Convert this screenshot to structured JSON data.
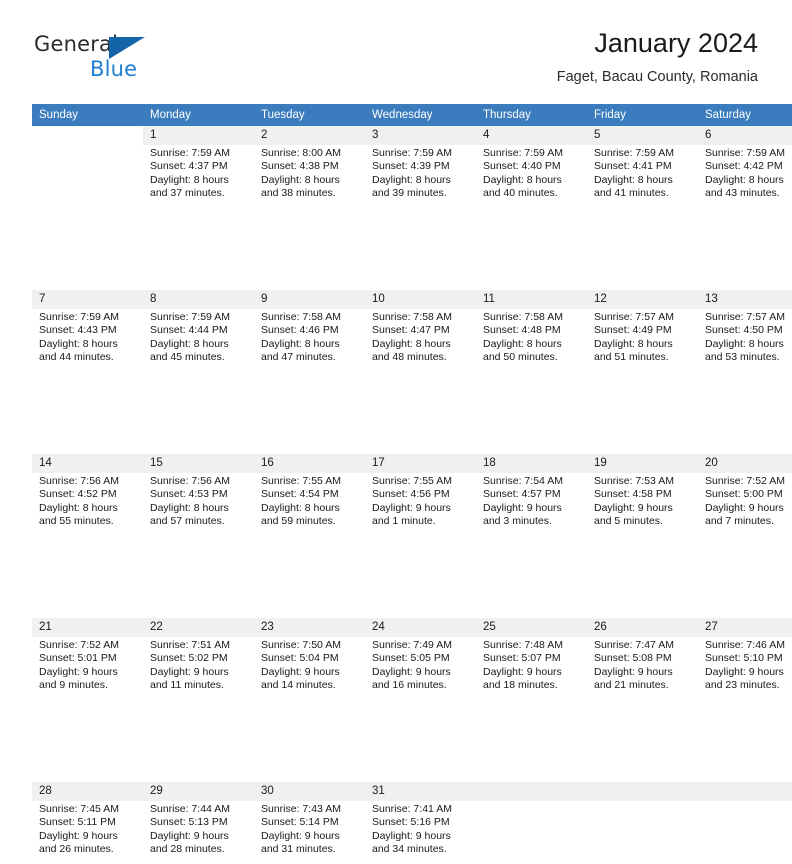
{
  "brand": {
    "name_part1": "General",
    "name_part2": "Blue",
    "triangle_icon": "blue-triangle-icon",
    "accent_color": "#1f7fd0",
    "triangle_color": "#1464aa"
  },
  "header": {
    "title": "January 2024",
    "subtitle": "Faget, Bacau County, Romania"
  },
  "calendar": {
    "header_bg": "#3a7cbe",
    "daynum_bg": "#f0f0f0",
    "weekdays": [
      "Sunday",
      "Monday",
      "Tuesday",
      "Wednesday",
      "Thursday",
      "Friday",
      "Saturday"
    ],
    "weeks": [
      [
        {
          "day": "",
          "blank": true,
          "sunrise": "",
          "sunset": "",
          "daylight1": "",
          "daylight2": ""
        },
        {
          "day": "1",
          "sunrise": "Sunrise: 7:59 AM",
          "sunset": "Sunset: 4:37 PM",
          "daylight1": "Daylight: 8 hours",
          "daylight2": "and 37 minutes."
        },
        {
          "day": "2",
          "sunrise": "Sunrise: 8:00 AM",
          "sunset": "Sunset: 4:38 PM",
          "daylight1": "Daylight: 8 hours",
          "daylight2": "and 38 minutes."
        },
        {
          "day": "3",
          "sunrise": "Sunrise: 7:59 AM",
          "sunset": "Sunset: 4:39 PM",
          "daylight1": "Daylight: 8 hours",
          "daylight2": "and 39 minutes."
        },
        {
          "day": "4",
          "sunrise": "Sunrise: 7:59 AM",
          "sunset": "Sunset: 4:40 PM",
          "daylight1": "Daylight: 8 hours",
          "daylight2": "and 40 minutes."
        },
        {
          "day": "5",
          "sunrise": "Sunrise: 7:59 AM",
          "sunset": "Sunset: 4:41 PM",
          "daylight1": "Daylight: 8 hours",
          "daylight2": "and 41 minutes."
        },
        {
          "day": "6",
          "sunrise": "Sunrise: 7:59 AM",
          "sunset": "Sunset: 4:42 PM",
          "daylight1": "Daylight: 8 hours",
          "daylight2": "and 43 minutes."
        }
      ],
      [
        {
          "day": "7",
          "sunrise": "Sunrise: 7:59 AM",
          "sunset": "Sunset: 4:43 PM",
          "daylight1": "Daylight: 8 hours",
          "daylight2": "and 44 minutes."
        },
        {
          "day": "8",
          "sunrise": "Sunrise: 7:59 AM",
          "sunset": "Sunset: 4:44 PM",
          "daylight1": "Daylight: 8 hours",
          "daylight2": "and 45 minutes."
        },
        {
          "day": "9",
          "sunrise": "Sunrise: 7:58 AM",
          "sunset": "Sunset: 4:46 PM",
          "daylight1": "Daylight: 8 hours",
          "daylight2": "and 47 minutes."
        },
        {
          "day": "10",
          "sunrise": "Sunrise: 7:58 AM",
          "sunset": "Sunset: 4:47 PM",
          "daylight1": "Daylight: 8 hours",
          "daylight2": "and 48 minutes."
        },
        {
          "day": "11",
          "sunrise": "Sunrise: 7:58 AM",
          "sunset": "Sunset: 4:48 PM",
          "daylight1": "Daylight: 8 hours",
          "daylight2": "and 50 minutes."
        },
        {
          "day": "12",
          "sunrise": "Sunrise: 7:57 AM",
          "sunset": "Sunset: 4:49 PM",
          "daylight1": "Daylight: 8 hours",
          "daylight2": "and 51 minutes."
        },
        {
          "day": "13",
          "sunrise": "Sunrise: 7:57 AM",
          "sunset": "Sunset: 4:50 PM",
          "daylight1": "Daylight: 8 hours",
          "daylight2": "and 53 minutes."
        }
      ],
      [
        {
          "day": "14",
          "sunrise": "Sunrise: 7:56 AM",
          "sunset": "Sunset: 4:52 PM",
          "daylight1": "Daylight: 8 hours",
          "daylight2": "and 55 minutes."
        },
        {
          "day": "15",
          "sunrise": "Sunrise: 7:56 AM",
          "sunset": "Sunset: 4:53 PM",
          "daylight1": "Daylight: 8 hours",
          "daylight2": "and 57 minutes."
        },
        {
          "day": "16",
          "sunrise": "Sunrise: 7:55 AM",
          "sunset": "Sunset: 4:54 PM",
          "daylight1": "Daylight: 8 hours",
          "daylight2": "and 59 minutes."
        },
        {
          "day": "17",
          "sunrise": "Sunrise: 7:55 AM",
          "sunset": "Sunset: 4:56 PM",
          "daylight1": "Daylight: 9 hours",
          "daylight2": "and 1 minute."
        },
        {
          "day": "18",
          "sunrise": "Sunrise: 7:54 AM",
          "sunset": "Sunset: 4:57 PM",
          "daylight1": "Daylight: 9 hours",
          "daylight2": "and 3 minutes."
        },
        {
          "day": "19",
          "sunrise": "Sunrise: 7:53 AM",
          "sunset": "Sunset: 4:58 PM",
          "daylight1": "Daylight: 9 hours",
          "daylight2": "and 5 minutes."
        },
        {
          "day": "20",
          "sunrise": "Sunrise: 7:52 AM",
          "sunset": "Sunset: 5:00 PM",
          "daylight1": "Daylight: 9 hours",
          "daylight2": "and 7 minutes."
        }
      ],
      [
        {
          "day": "21",
          "sunrise": "Sunrise: 7:52 AM",
          "sunset": "Sunset: 5:01 PM",
          "daylight1": "Daylight: 9 hours",
          "daylight2": "and 9 minutes."
        },
        {
          "day": "22",
          "sunrise": "Sunrise: 7:51 AM",
          "sunset": "Sunset: 5:02 PM",
          "daylight1": "Daylight: 9 hours",
          "daylight2": "and 11 minutes."
        },
        {
          "day": "23",
          "sunrise": "Sunrise: 7:50 AM",
          "sunset": "Sunset: 5:04 PM",
          "daylight1": "Daylight: 9 hours",
          "daylight2": "and 14 minutes."
        },
        {
          "day": "24",
          "sunrise": "Sunrise: 7:49 AM",
          "sunset": "Sunset: 5:05 PM",
          "daylight1": "Daylight: 9 hours",
          "daylight2": "and 16 minutes."
        },
        {
          "day": "25",
          "sunrise": "Sunrise: 7:48 AM",
          "sunset": "Sunset: 5:07 PM",
          "daylight1": "Daylight: 9 hours",
          "daylight2": "and 18 minutes."
        },
        {
          "day": "26",
          "sunrise": "Sunrise: 7:47 AM",
          "sunset": "Sunset: 5:08 PM",
          "daylight1": "Daylight: 9 hours",
          "daylight2": "and 21 minutes."
        },
        {
          "day": "27",
          "sunrise": "Sunrise: 7:46 AM",
          "sunset": "Sunset: 5:10 PM",
          "daylight1": "Daylight: 9 hours",
          "daylight2": "and 23 minutes."
        }
      ],
      [
        {
          "day": "28",
          "sunrise": "Sunrise: 7:45 AM",
          "sunset": "Sunset: 5:11 PM",
          "daylight1": "Daylight: 9 hours",
          "daylight2": "and 26 minutes."
        },
        {
          "day": "29",
          "sunrise": "Sunrise: 7:44 AM",
          "sunset": "Sunset: 5:13 PM",
          "daylight1": "Daylight: 9 hours",
          "daylight2": "and 28 minutes."
        },
        {
          "day": "30",
          "sunrise": "Sunrise: 7:43 AM",
          "sunset": "Sunset: 5:14 PM",
          "daylight1": "Daylight: 9 hours",
          "daylight2": "and 31 minutes."
        },
        {
          "day": "31",
          "sunrise": "Sunrise: 7:41 AM",
          "sunset": "Sunset: 5:16 PM",
          "daylight1": "Daylight: 9 hours",
          "daylight2": "and 34 minutes."
        },
        {
          "day": "",
          "empty": true,
          "sunrise": "",
          "sunset": "",
          "daylight1": "",
          "daylight2": ""
        },
        {
          "day": "",
          "empty": true,
          "sunrise": "",
          "sunset": "",
          "daylight1": "",
          "daylight2": ""
        },
        {
          "day": "",
          "empty": true,
          "sunrise": "",
          "sunset": "",
          "daylight1": "",
          "daylight2": ""
        }
      ]
    ]
  }
}
